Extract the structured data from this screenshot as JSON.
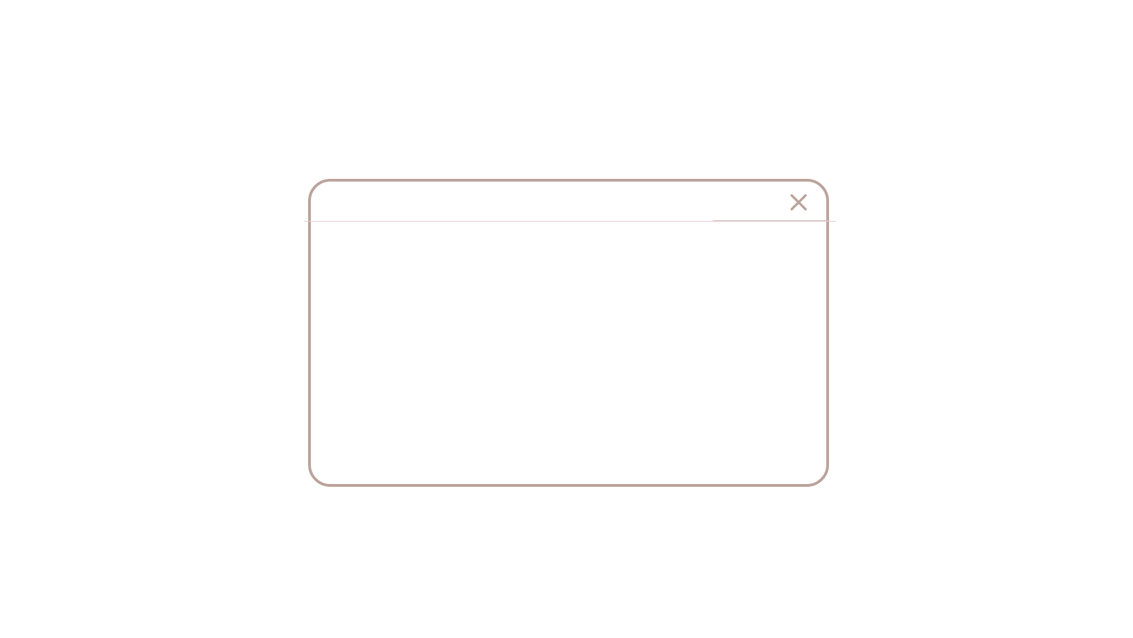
{
  "dialog": {
    "title": "",
    "body_text": "",
    "close_icon": "close-icon",
    "border_color": "#bba39b",
    "divider_color": "#e1cacb"
  }
}
